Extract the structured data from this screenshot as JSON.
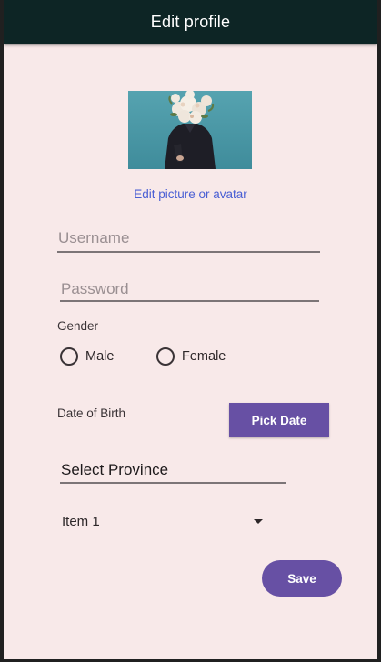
{
  "appbar": {
    "title": "Edit profile"
  },
  "avatar": {
    "link_label": "Edit picture or avatar"
  },
  "form": {
    "username": {
      "placeholder": "Username",
      "value": ""
    },
    "password": {
      "placeholder": "Password",
      "value": ""
    },
    "gender": {
      "label": "Gender",
      "options": [
        {
          "label": "Male",
          "selected": false
        },
        {
          "label": "Female",
          "selected": false
        }
      ]
    },
    "dob": {
      "label": "Date of Birth",
      "button_label": "Pick Date"
    },
    "province": {
      "label": "Select Province"
    },
    "spinner": {
      "selected": "Item 1"
    },
    "save_label": "Save"
  },
  "colors": {
    "appbar": "#0d2525",
    "background": "#f8e9e9",
    "accent": "#6750a4",
    "link": "#4a5fd4"
  },
  "icons": {
    "spinner": "dropdown-caret-icon"
  }
}
